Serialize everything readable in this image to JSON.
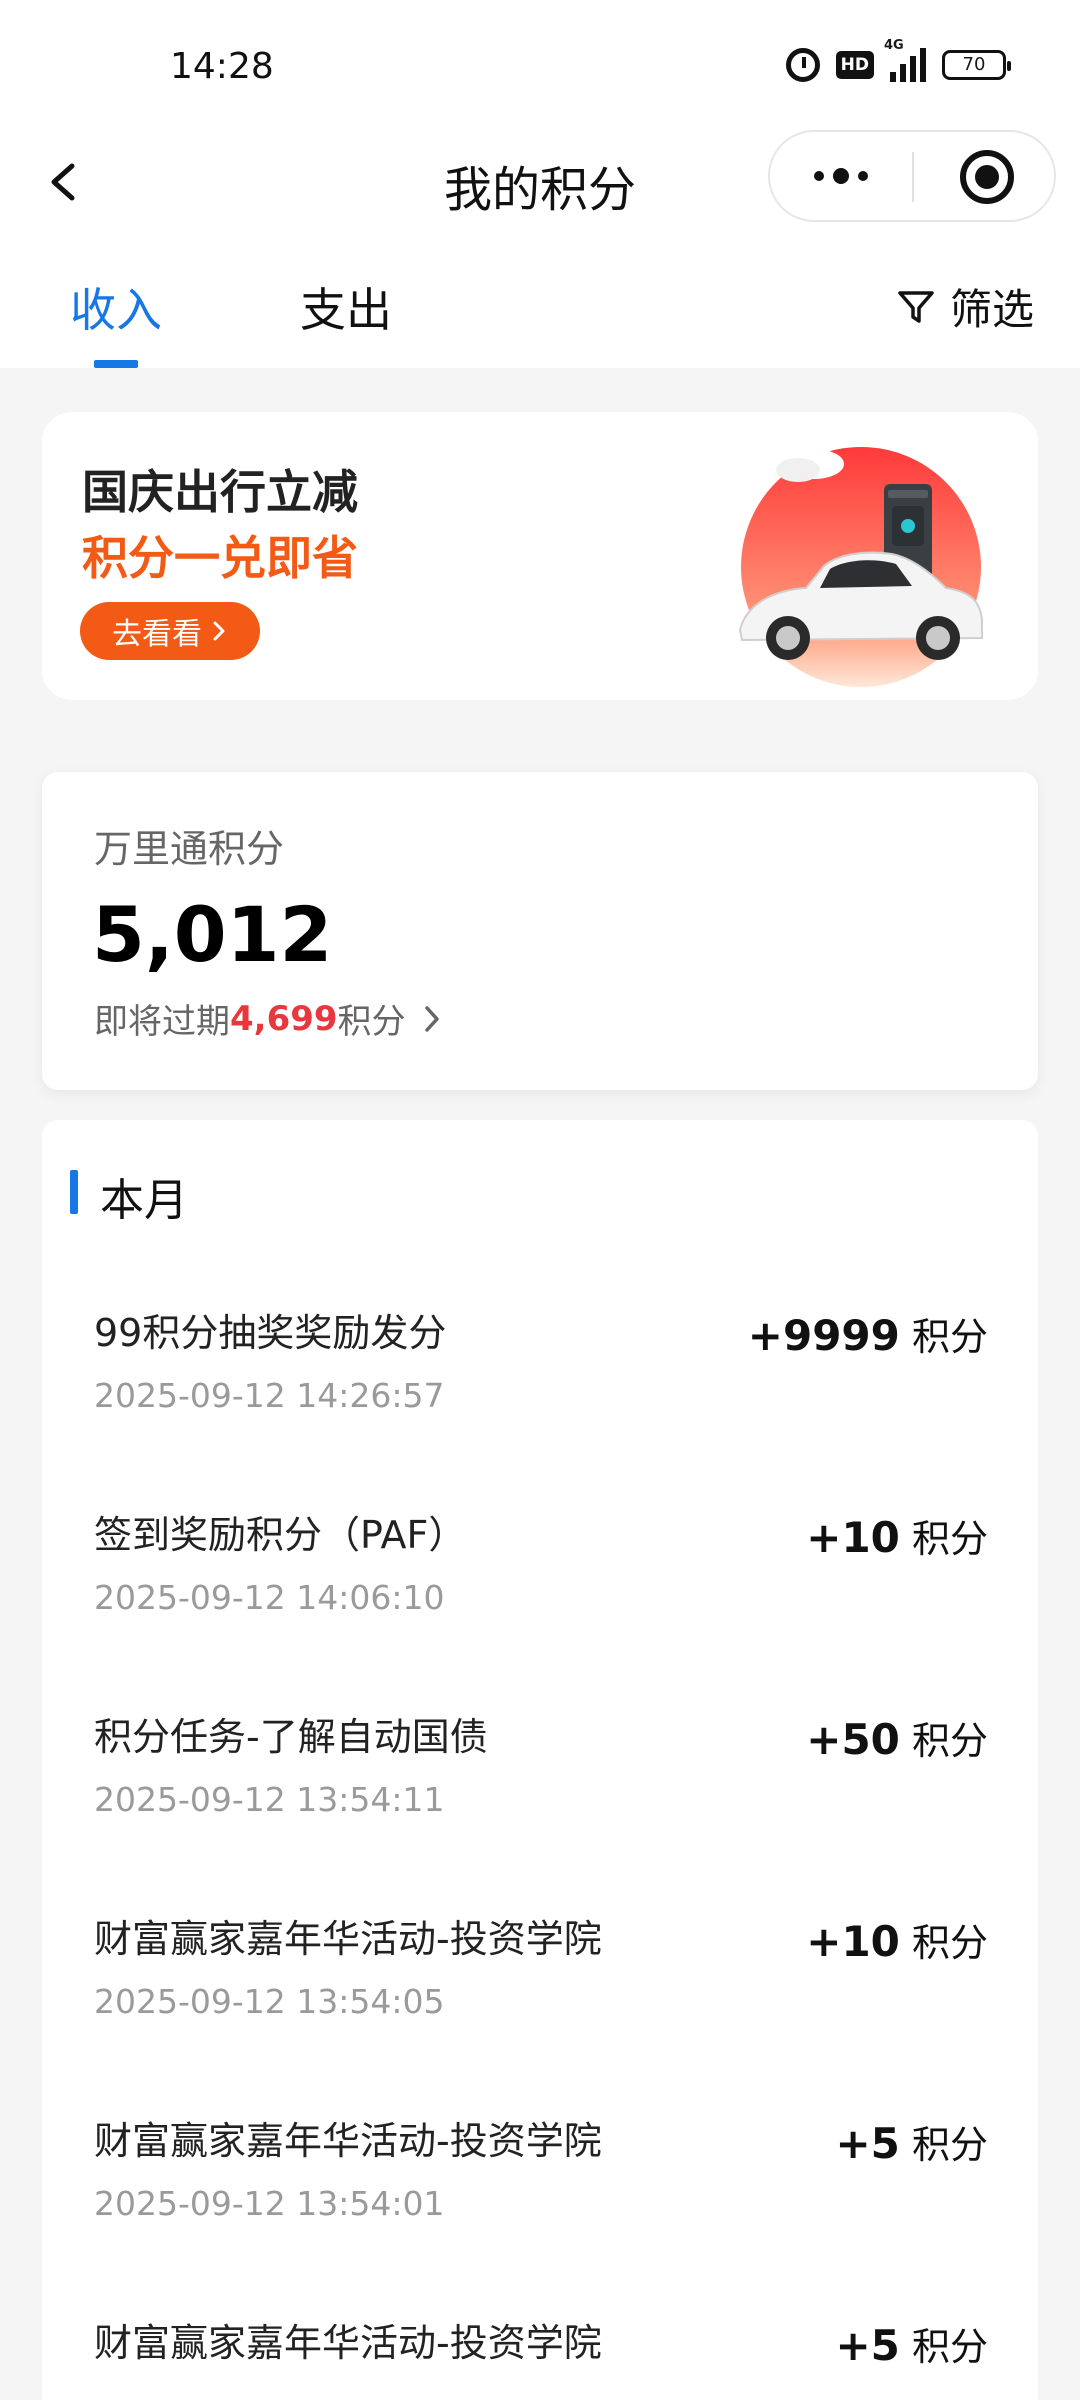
{
  "status_bar": {
    "time": "14:28",
    "network": "4G",
    "hd": "HD",
    "battery": "70"
  },
  "nav": {
    "title": "我的积分"
  },
  "tabs": {
    "income": "收入",
    "expense": "支出",
    "filter": "筛选"
  },
  "banner": {
    "line1": "国庆出行立减",
    "line2": "积分一兑即省",
    "button": "去看看"
  },
  "points": {
    "label": "万里通积分",
    "value": "5,012",
    "expire_prefix": "即将过期",
    "expire_amount": "4,699",
    "expire_suffix": "积分"
  },
  "records": {
    "month": "本月",
    "unit": "积分",
    "items": [
      {
        "title": "99积分抽奖奖励发分",
        "time": "2025-09-12 14:26:57",
        "amount": "+9999"
      },
      {
        "title": "签到奖励积分（PAF）",
        "time": "2025-09-12 14:06:10",
        "amount": "+10"
      },
      {
        "title": "积分任务-了解自动国债",
        "time": "2025-09-12 13:54:11",
        "amount": "+50"
      },
      {
        "title": "财富赢家嘉年华活动-投资学院",
        "time": "2025-09-12 13:54:05",
        "amount": "+10"
      },
      {
        "title": "财富赢家嘉年华活动-投资学院",
        "time": "2025-09-12 13:54:01",
        "amount": "+5"
      },
      {
        "title": "财富赢家嘉年华活动-投资学院",
        "time": "",
        "amount": "+5"
      }
    ]
  },
  "colors": {
    "accent": "#1677e6",
    "promo": "#f25a16",
    "expire": "#e8383d"
  }
}
